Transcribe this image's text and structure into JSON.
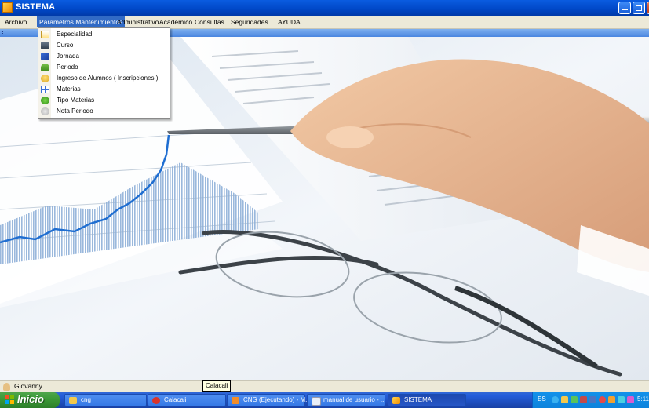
{
  "window": {
    "title": "SISTEMA"
  },
  "menubar": {
    "items": [
      {
        "label": "Archivo"
      },
      {
        "label": "Parametros Mantenimientos"
      },
      {
        "label": "Administrativo"
      },
      {
        "label": "Academico"
      },
      {
        "label": "Consultas"
      },
      {
        "label": "Seguridades"
      },
      {
        "label": "AYUDA"
      }
    ],
    "open_menu": {
      "items": [
        {
          "label": "Especialidad"
        },
        {
          "label": "Curso"
        },
        {
          "label": "Jornada"
        },
        {
          "label": "Periodo"
        },
        {
          "label": "Ingreso de Alumnos ( Inscripciones )"
        },
        {
          "label": "Materias"
        },
        {
          "label": "Tipo Materias"
        },
        {
          "label": "Nota Periodo"
        }
      ]
    }
  },
  "statusbar": {
    "user": "Giovanny"
  },
  "tooltip": {
    "text": "Calacali"
  },
  "taskbar": {
    "start_label": "Inicio",
    "tasks": [
      {
        "label": "cng"
      },
      {
        "label": "Calacali"
      },
      {
        "label": "CNG (Ejecutando) - M..."
      },
      {
        "label": "manual de usuario - ..."
      },
      {
        "label": "SISTEMA"
      }
    ],
    "tray": {
      "language": "ES",
      "clock": "5:11"
    }
  },
  "colors": {
    "titlebar": "#0047c6",
    "menu_highlight": "#316ac5",
    "start_button": "#3c9a37",
    "taskbar": "#245edb"
  }
}
